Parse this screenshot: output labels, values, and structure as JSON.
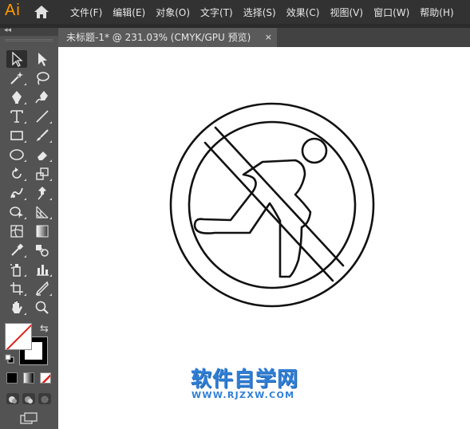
{
  "app": {
    "logo": "Ai"
  },
  "menu": [
    "文件(F)",
    "编辑(E)",
    "对象(O)",
    "文字(T)",
    "选择(S)",
    "效果(C)",
    "视图(V)",
    "窗口(W)",
    "帮助(H)"
  ],
  "document_tab": {
    "title": "未标题-1* @ 231.03% (CMYK/GPU 预览)",
    "close": "×"
  },
  "toolbar": {
    "collapse": "◂◂",
    "swap": "⇆",
    "tools": [
      {
        "name": "selection-tool",
        "icon": "selection-arrow-icon",
        "active": true
      },
      {
        "name": "direct-selection-tool",
        "icon": "direct-selection-arrow-icon"
      },
      {
        "name": "magic-wand-tool",
        "icon": "magic-wand-icon"
      },
      {
        "name": "lasso-tool",
        "icon": "lasso-icon"
      },
      {
        "name": "pen-tool",
        "icon": "pen-icon"
      },
      {
        "name": "curvature-tool",
        "icon": "curvature-pen-icon"
      },
      {
        "name": "type-tool",
        "icon": "type-icon"
      },
      {
        "name": "line-segment-tool",
        "icon": "line-icon"
      },
      {
        "name": "rectangle-tool",
        "icon": "rectangle-icon"
      },
      {
        "name": "paintbrush-tool",
        "icon": "paintbrush-icon"
      },
      {
        "name": "ellipse-tool",
        "icon": "ellipse-icon"
      },
      {
        "name": "eraser-tool",
        "icon": "eraser-icon"
      },
      {
        "name": "rotate-tool",
        "icon": "rotate-icon"
      },
      {
        "name": "scale-tool",
        "icon": "scale-icon"
      },
      {
        "name": "warp-tool",
        "icon": "warp-icon"
      },
      {
        "name": "puppet-warp-tool",
        "icon": "pin-icon"
      },
      {
        "name": "shape-builder-tool",
        "icon": "shape-builder-icon"
      },
      {
        "name": "perspective-grid-tool",
        "icon": "perspective-grid-icon"
      },
      {
        "name": "mesh-tool",
        "icon": "mesh-icon"
      },
      {
        "name": "gradient-tool",
        "icon": "gradient-icon"
      },
      {
        "name": "eyedropper-tool",
        "icon": "eyedropper-icon"
      },
      {
        "name": "blend-tool",
        "icon": "blend-icon"
      },
      {
        "name": "symbol-sprayer-tool",
        "icon": "symbol-sprayer-icon"
      },
      {
        "name": "column-graph-tool",
        "icon": "column-graph-icon"
      },
      {
        "name": "artboard-tool",
        "icon": "artboard-icon"
      },
      {
        "name": "slice-tool",
        "icon": "slice-icon"
      },
      {
        "name": "hand-tool",
        "icon": "hand-icon"
      },
      {
        "name": "zoom-tool",
        "icon": "zoom-icon"
      }
    ]
  },
  "colors": {
    "fill": "#ffffff",
    "stroke": "#000000",
    "watermark": "#2f7fd6",
    "menu_bg": "#323232",
    "panel_bg": "#535353"
  },
  "watermark": {
    "title": "软件自学网",
    "url": "WWW.RJZXW.COM"
  }
}
